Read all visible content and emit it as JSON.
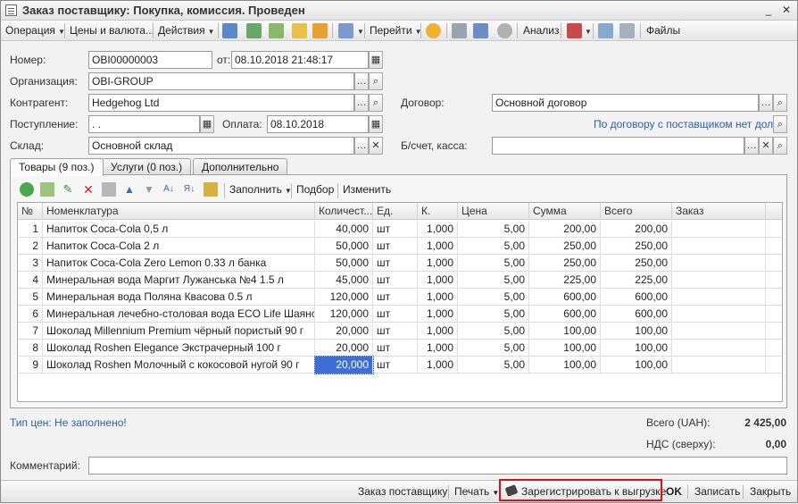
{
  "window": {
    "title": "Заказ поставщику: Покупка, комиссия. Проведен"
  },
  "toolbar": {
    "operation": "Операция",
    "prices": "Цены и валюта...",
    "actions": "Действия",
    "goto": "Перейти",
    "analysis": "Анализ",
    "files": "Файлы"
  },
  "header": {
    "number_label": "Номер:",
    "number_value": "OBI00000003",
    "date_label": "от:",
    "date_value": "08.10.2018 21:48:17",
    "org_label": "Организация:",
    "org_value": "OBI-GROUP",
    "counterparty_label": "Контрагент:",
    "counterparty_value": "Hedgehog Ltd",
    "contract_label": "Договор:",
    "contract_value": "Основной договор",
    "receipt_label": "Поступление:",
    "receipt_value": " .  .",
    "payment_label": "Оплата:",
    "payment_value": "08.10.2018",
    "contract_link": "По договору с поставщиком нет долга",
    "warehouse_label": "Склад:",
    "warehouse_value": "Основной склад",
    "account_label": "Б/счет, касса:",
    "account_value": ""
  },
  "tabs": [
    {
      "label": "Товары (9 поз.)"
    },
    {
      "label": "Услуги (0 поз.)"
    },
    {
      "label": "Дополнительно"
    }
  ],
  "grid_toolbar": {
    "fill": "Заполнить",
    "selection": "Подбор",
    "change": "Изменить"
  },
  "table": {
    "columns": [
      "№",
      "Номенклатура",
      "Количест...",
      "Ед.",
      "К.",
      "Цена",
      "Сумма",
      "Всего",
      "Заказ"
    ],
    "rows": [
      [
        "1",
        "Напиток Coca-Cola 0,5 л",
        "40,000",
        "шт",
        "1,000",
        "5,00",
        "200,00",
        "200,00",
        ""
      ],
      [
        "2",
        "Напиток Coca-Cola 2 л",
        "50,000",
        "шт",
        "1,000",
        "5,00",
        "250,00",
        "250,00",
        ""
      ],
      [
        "3",
        "Напиток Coca-Cola Zero Lemon 0.33 л банка",
        "50,000",
        "шт",
        "1,000",
        "5,00",
        "250,00",
        "250,00",
        ""
      ],
      [
        "4",
        "Минеральная вода Маргит Лужанська №4 1.5 л",
        "45,000",
        "шт",
        "1,000",
        "5,00",
        "225,00",
        "225,00",
        ""
      ],
      [
        "5",
        "Минеральная вода Поляна Квасова 0.5 л",
        "120,000",
        "шт",
        "1,000",
        "5,00",
        "600,00",
        "600,00",
        ""
      ],
      [
        "6",
        "Минеральная лечебно-столовая вода ECO Life Шаянска...",
        "120,000",
        "шт",
        "1,000",
        "5,00",
        "600,00",
        "600,00",
        ""
      ],
      [
        "7",
        "Шоколад Millennium Premium чёрный пористый 90 г",
        "20,000",
        "шт",
        "1,000",
        "5,00",
        "100,00",
        "100,00",
        ""
      ],
      [
        "8",
        "Шоколад Roshen Elegance Экстрачерный 100 г",
        "20,000",
        "шт",
        "1,000",
        "5,00",
        "100,00",
        "100,00",
        ""
      ],
      [
        "9",
        "Шоколад Roshen Молочный с кокосовой нугой 90 г",
        "20,000",
        "шт",
        "1,000",
        "5,00",
        "100,00",
        "100,00",
        ""
      ]
    ]
  },
  "footer": {
    "price_type_link": "Тип цен: Не заполнено!",
    "total_label": "Всего (UAH):",
    "total_value": "2 425,00",
    "vat_label": "НДС (сверху):",
    "vat_value": "0,00",
    "comment_label": "Комментарий:",
    "comment_value": ""
  },
  "bottombar": {
    "supplier_order": "Заказ поставщику",
    "print": "Печать",
    "register": "Зарегистрировать к выгрузке",
    "ok": "OK",
    "save": "Записать",
    "close": "Закрыть"
  },
  "colors": {
    "link": "#2b5fa8",
    "selection": "#3d6fd6",
    "highlight": "#e01010"
  }
}
